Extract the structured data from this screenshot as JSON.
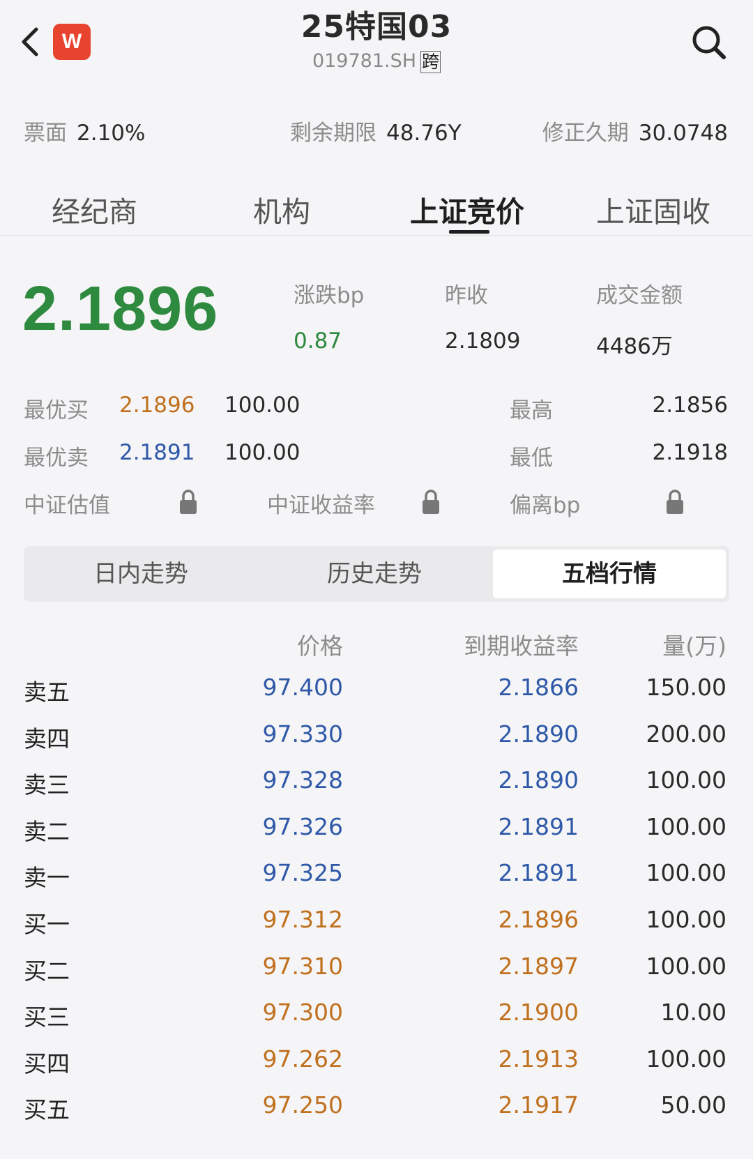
{
  "header": {
    "title": "25特国03",
    "code": "019781.SH",
    "market_tag": "跨",
    "logo_letter": "W"
  },
  "bond_info": {
    "coupon_label": "票面",
    "coupon_value": "2.10%",
    "remaining_label": "剩余期限",
    "remaining_value": "48.76Y",
    "duration_label": "修正久期",
    "duration_value": "30.0748"
  },
  "main_tabs": [
    "经纪商",
    "机构",
    "上证竞价",
    "上证固收"
  ],
  "active_main_tab": "上证竞价",
  "quote": {
    "last": "2.1896",
    "change_label": "涨跌bp",
    "change_value": "0.87",
    "prev_close_label": "昨收",
    "prev_close_value": "2.1809",
    "turnover_label": "成交金额",
    "turnover_value": "4486万",
    "best_bid_label": "最优买",
    "best_bid_price": "2.1896",
    "best_bid_vol": "100.00",
    "best_ask_label": "最优卖",
    "best_ask_price": "2.1891",
    "best_ask_vol": "100.00",
    "high_label": "最高",
    "high_value": "2.1856",
    "low_label": "最低",
    "low_value": "2.1918",
    "csi_val_label": "中证估值",
    "csi_yield_label": "中证收益率",
    "deviation_label": "偏离bp"
  },
  "segments": [
    "日内走势",
    "历史走势",
    "五档行情"
  ],
  "active_segment": "五档行情",
  "order_book": {
    "headers": {
      "price": "价格",
      "ytm": "到期收益率",
      "volume": "量(万)"
    },
    "rows": [
      {
        "level": "卖五",
        "side": "sell",
        "price": "97.400",
        "ytm": "2.1866",
        "volume": "150.00"
      },
      {
        "level": "卖四",
        "side": "sell",
        "price": "97.330",
        "ytm": "2.1890",
        "volume": "200.00"
      },
      {
        "level": "卖三",
        "side": "sell",
        "price": "97.328",
        "ytm": "2.1890",
        "volume": "100.00"
      },
      {
        "level": "卖二",
        "side": "sell",
        "price": "97.326",
        "ytm": "2.1891",
        "volume": "100.00"
      },
      {
        "level": "卖一",
        "side": "sell",
        "price": "97.325",
        "ytm": "2.1891",
        "volume": "100.00"
      },
      {
        "level": "买一",
        "side": "buy",
        "price": "97.312",
        "ytm": "2.1896",
        "volume": "100.00"
      },
      {
        "level": "买二",
        "side": "buy",
        "price": "97.310",
        "ytm": "2.1897",
        "volume": "100.00"
      },
      {
        "level": "买三",
        "side": "buy",
        "price": "97.300",
        "ytm": "2.1900",
        "volume": "10.00"
      },
      {
        "level": "买四",
        "side": "buy",
        "price": "97.262",
        "ytm": "2.1913",
        "volume": "100.00"
      },
      {
        "level": "买五",
        "side": "buy",
        "price": "97.250",
        "ytm": "2.1917",
        "volume": "50.00"
      }
    ]
  },
  "colors": {
    "up_green": "#2e8a3e",
    "bid_orange": "#c0701e",
    "ask_blue": "#2f59a8",
    "logo_red": "#e8432f"
  }
}
